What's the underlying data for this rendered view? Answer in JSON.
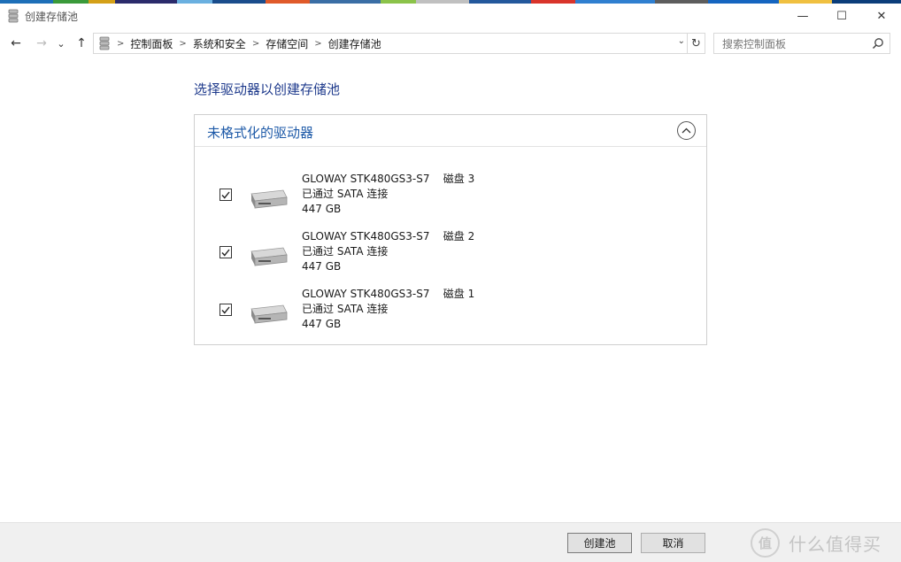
{
  "window": {
    "title": "创建存储池",
    "minimize_glyph": "—",
    "maximize_glyph": "☐",
    "close_glyph": "✕"
  },
  "navigation": {
    "back_glyph": "←",
    "forward_glyph": "→",
    "recent_glyph": "⌄",
    "up_glyph": "↑",
    "breadcrumbs": [
      "控制面板",
      "系统和安全",
      "存储空间",
      "创建存储池"
    ],
    "separator_glyph": ">",
    "dropdown_glyph": "⌄",
    "refresh_glyph": "↻"
  },
  "search": {
    "placeholder": "搜索控制面板"
  },
  "main": {
    "heading": "选择驱动器以创建存储池",
    "group": {
      "title": "未格式化的驱动器",
      "drives": [
        {
          "model": "GLOWAY STK480GS3-S7",
          "disk": "磁盘 3",
          "connection": "已通过 SATA 连接",
          "size": "447 GB",
          "checked": true
        },
        {
          "model": "GLOWAY STK480GS3-S7",
          "disk": "磁盘 2",
          "connection": "已通过 SATA 连接",
          "size": "447 GB",
          "checked": true
        },
        {
          "model": "GLOWAY STK480GS3-S7",
          "disk": "磁盘 1",
          "connection": "已通过 SATA 连接",
          "size": "447 GB",
          "checked": true
        }
      ]
    }
  },
  "footer": {
    "create_label": "创建池",
    "cancel_label": "取消"
  },
  "watermark": {
    "logo_text": "值",
    "text": "什么值得买"
  },
  "colors": {
    "heading": "#1e3a8c",
    "group_title": "#1e5aa8",
    "footer_bg": "#f0f0f0"
  }
}
